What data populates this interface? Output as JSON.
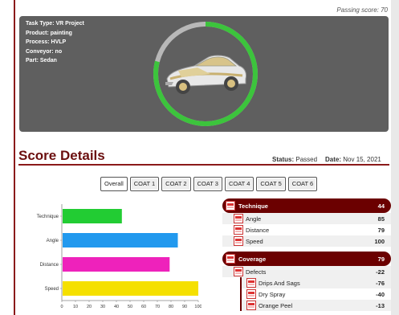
{
  "passing_score": "Passing score: 70",
  "task_info": {
    "task_type": "Task Type: VR Project",
    "product": "Product: painting",
    "process": "Process: HVLP",
    "conveyor": "Conveyor: no",
    "part": "Part: Sedan"
  },
  "score_details": {
    "title": "Score Details",
    "status_label": "Status:",
    "status_value": "Passed",
    "date_label": "Date:",
    "date_value": "Nov 15, 2021"
  },
  "badge": "?",
  "tabs": [
    "Overall",
    "COAT 1",
    "COAT 2",
    "COAT 3",
    "COAT 4",
    "COAT 5",
    "COAT 6"
  ],
  "chart_data": {
    "type": "bar",
    "orientation": "horizontal",
    "categories": [
      "Technique",
      "Angle",
      "Distance",
      "Speed"
    ],
    "values": [
      44,
      85,
      79,
      100
    ],
    "colors": [
      "#22cc33",
      "#2299ee",
      "#ee22bb",
      "#f5e000"
    ],
    "xlim": [
      0,
      100
    ],
    "xticks": [
      "0",
      "10",
      "20",
      "30",
      "40",
      "50",
      "60",
      "70",
      "80",
      "90",
      "100"
    ]
  },
  "table": {
    "technique": {
      "label": "Technique",
      "value": "44",
      "rows": [
        {
          "label": "Angle",
          "value": "85"
        },
        {
          "label": "Distance",
          "value": "79"
        },
        {
          "label": "Speed",
          "value": "100"
        }
      ]
    },
    "coverage": {
      "label": "Coverage",
      "value": "79",
      "defects": {
        "label": "Defects",
        "value": "-22"
      },
      "sub_rows": [
        {
          "label": "Drips And Sags",
          "value": "-76"
        },
        {
          "label": "Dry Spray",
          "value": "-40"
        },
        {
          "label": "Orange Peel",
          "value": "-13"
        }
      ]
    }
  },
  "colors": {
    "accent": "#6b0000",
    "ring_progress": "#3cc43c",
    "ring_track": "#b8b8b8",
    "preview_bg": "#5f5f5f"
  }
}
